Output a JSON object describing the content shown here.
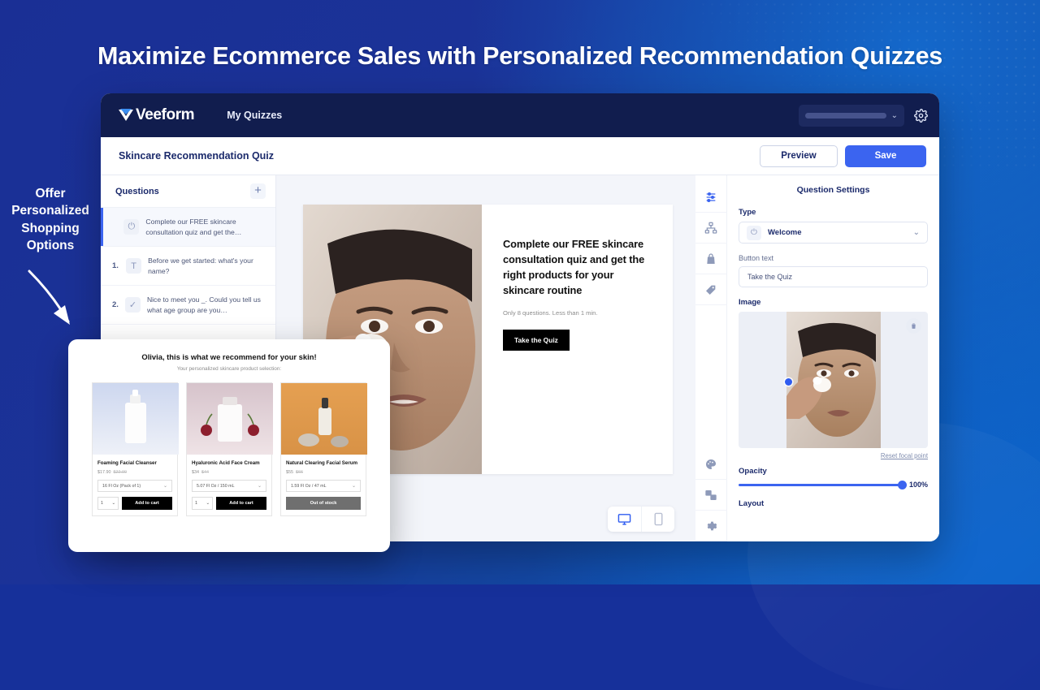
{
  "page": {
    "headline": "Maximize Ecommerce Sales with Personalized Recommendation Quizzes",
    "annotation": "Offer Personalized Shopping Options",
    "bg_color_start": "#1a2f95",
    "bg_color_end": "#0d5fbd"
  },
  "topbar": {
    "brand": "Veeform",
    "nav": "My Quizzes",
    "account_value": "",
    "chevron": "⌄",
    "gear_icon": "gear-icon"
  },
  "subbar": {
    "quiz_title": "Skincare Recommendation Quiz",
    "preview_label": "Preview",
    "save_label": "Save",
    "save_color": "#3b64f0"
  },
  "questions_panel": {
    "title": "Questions",
    "add_label": "+",
    "items": [
      {
        "num": "",
        "icon": "power-icon",
        "glyph": "⏻",
        "text": "Complete our FREE skincare consultation quiz and get the…",
        "active": true
      },
      {
        "num": "1.",
        "icon": "text-field-icon",
        "glyph": "T",
        "text": "Before we get started: what's your name?",
        "active": false
      },
      {
        "num": "2.",
        "icon": "checkmark-icon",
        "glyph": "✓",
        "text": "Nice to meet you _. Could you tell us what age group are you…",
        "active": false
      }
    ]
  },
  "canvas": {
    "slide_heading": "Complete our FREE skincare consultation quiz and get the right products for your skincare routine",
    "slide_sub": "Only 8 questions. Less than 1 min.",
    "slide_cta": "Take the Quiz",
    "device_desktop": "desktop-icon",
    "device_mobile": "mobile-icon"
  },
  "settings": {
    "panel_title": "Question Settings",
    "rail": [
      {
        "name": "sliders-icon",
        "active": true
      },
      {
        "name": "sitemap-icon",
        "active": false
      },
      {
        "name": "shopping-bag-icon",
        "active": false
      },
      {
        "name": "tag-icon",
        "active": false
      },
      {
        "name": "palette-icon",
        "active": false
      },
      {
        "name": "translate-icon",
        "active": false
      },
      {
        "name": "gear-icon",
        "active": false
      }
    ],
    "type_label": "Type",
    "type_value": "Welcome",
    "button_text_label": "Button text",
    "button_text_value": "Take the Quiz",
    "image_label": "Image",
    "reset_focal": "Reset focal point",
    "opacity_label": "Opacity",
    "opacity_value": "100%",
    "layout_label": "Layout",
    "chevron": "⌄",
    "trash_icon": "trash-icon"
  },
  "results_popup": {
    "heading": "Olivia, this is what we recommend for your skin!",
    "subheading": "Your personalized skincare product selection:",
    "products": [
      {
        "name": "Foaming Facial Cleanser",
        "price": "$17.90",
        "compare_at": "$22.00",
        "variant": "16 Fl Oz (Pack of 1)",
        "qty": "1",
        "action": "Add to cart",
        "in_stock": true
      },
      {
        "name": "Hyaluronic Acid Face Cream",
        "price": "$34",
        "compare_at": "$44",
        "variant": "5.07 Fl Oz / 150 mL",
        "qty": "1",
        "action": "Add to cart",
        "in_stock": true
      },
      {
        "name": "Natural Clearing Facial Serum",
        "price": "$55",
        "compare_at": "$66",
        "variant": "1.59 Fl Oz / 47 mL",
        "qty": "1",
        "action": "Out of stock",
        "in_stock": false
      }
    ]
  }
}
